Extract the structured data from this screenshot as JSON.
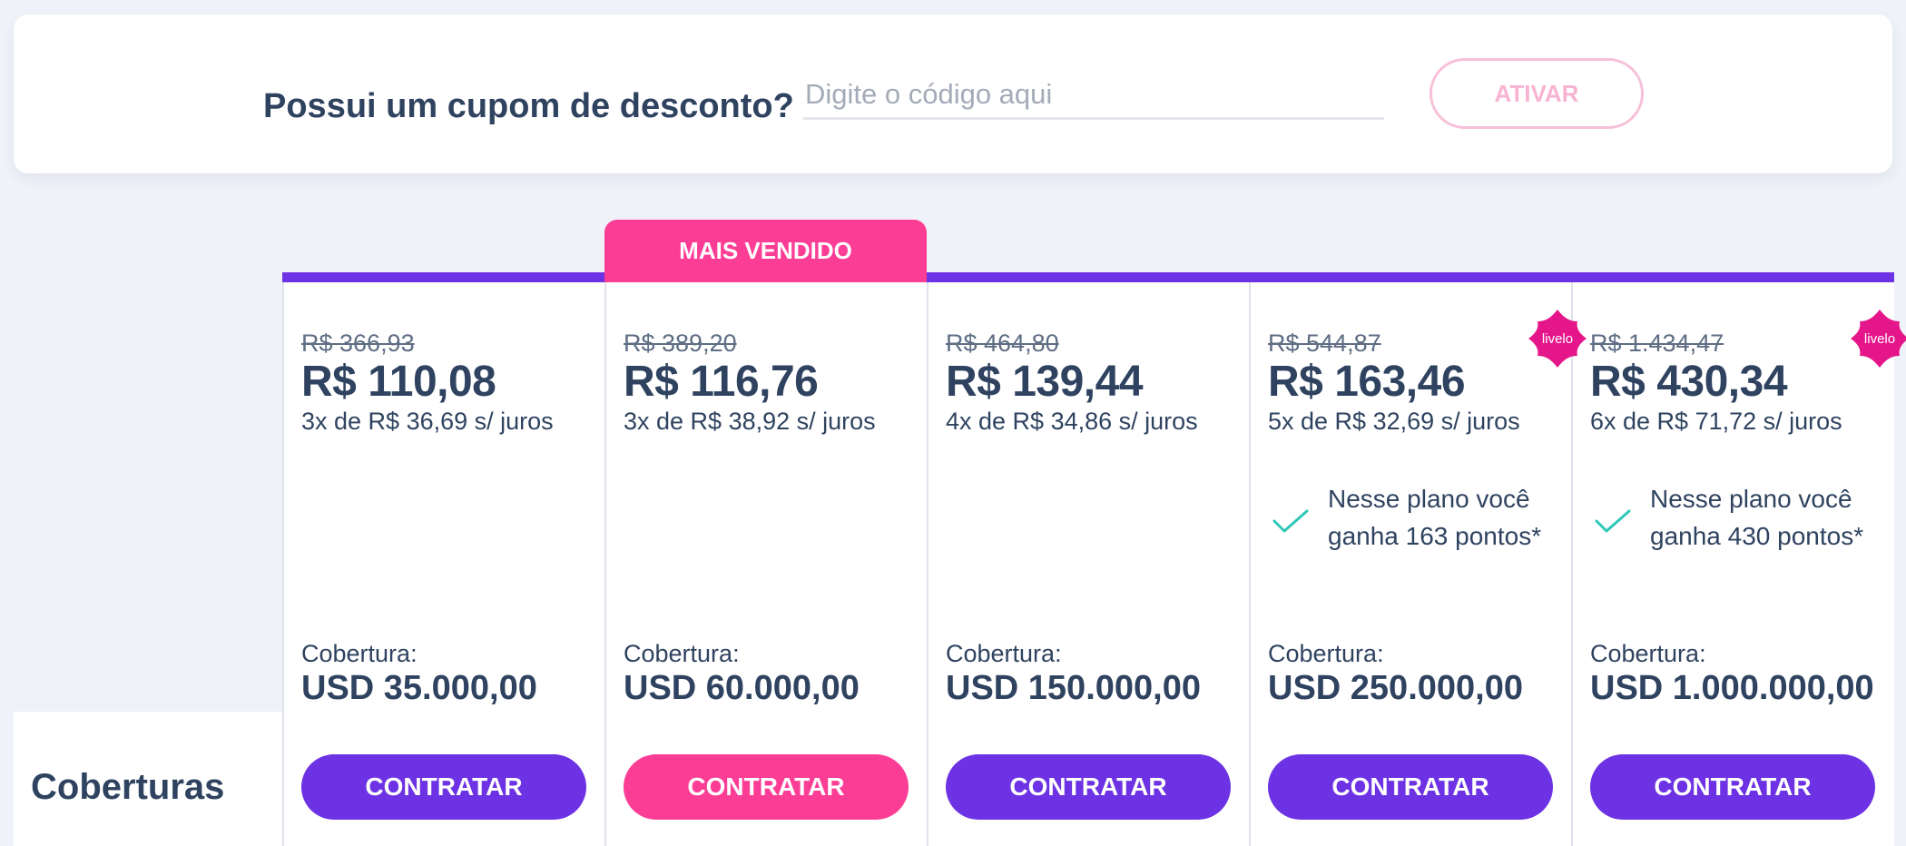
{
  "coupon": {
    "question": "Possui um cupom de desconto?",
    "placeholder": "Digite o código aqui",
    "value": "",
    "activate_label": "ATIVAR"
  },
  "table": {
    "row_label": "Coberturas",
    "badge_bestseller": "MAIS VENDIDO"
  },
  "plans": [
    {
      "old_price": "R$ 366,93",
      "price": "R$ 110,08",
      "installments": "3x de R$ 36,69 s/ juros",
      "coverage_label": "Cobertura:",
      "coverage_value": "USD 35.000,00",
      "button_label": "CONTRATAR"
    },
    {
      "old_price": "R$ 389,20",
      "price": "R$ 116,76",
      "installments": "3x de R$ 38,92 s/ juros",
      "coverage_label": "Cobertura:",
      "coverage_value": "USD 60.000,00",
      "button_label": "CONTRATAR"
    },
    {
      "old_price": "R$ 464,80",
      "price": "R$ 139,44",
      "installments": "4x de R$ 34,86 s/ juros",
      "coverage_label": "Cobertura:",
      "coverage_value": "USD 150.000,00",
      "button_label": "CONTRATAR"
    },
    {
      "old_price": "R$ 544,87",
      "price": "R$ 163,46",
      "installments": "5x de R$ 32,69 s/ juros",
      "livelo_logo_text": "livelo",
      "points_text": "Nesse plano você ganha 163 pontos*",
      "coverage_label": "Cobertura:",
      "coverage_value": "USD 250.000,00",
      "button_label": "CONTRATAR"
    },
    {
      "old_price": "R$ 1.434,47",
      "price": "R$ 430,34",
      "installments": "6x de R$ 71,72 s/ juros",
      "livelo_logo_text": "livelo",
      "points_text": "Nesse plano você ganha 430 pontos*",
      "coverage_label": "Cobertura:",
      "coverage_value": "USD 1.000.000,00",
      "button_label": "CONTRATAR"
    }
  ],
  "colors": {
    "primary_purple": "#6d32e3",
    "accent_pink": "#fc3d95",
    "text_dark": "#2f4360",
    "check_teal": "#2fc7b8",
    "page_background": "#eff2f8"
  },
  "icons": {
    "check": "check-icon",
    "livelo": "livelo-logo"
  }
}
